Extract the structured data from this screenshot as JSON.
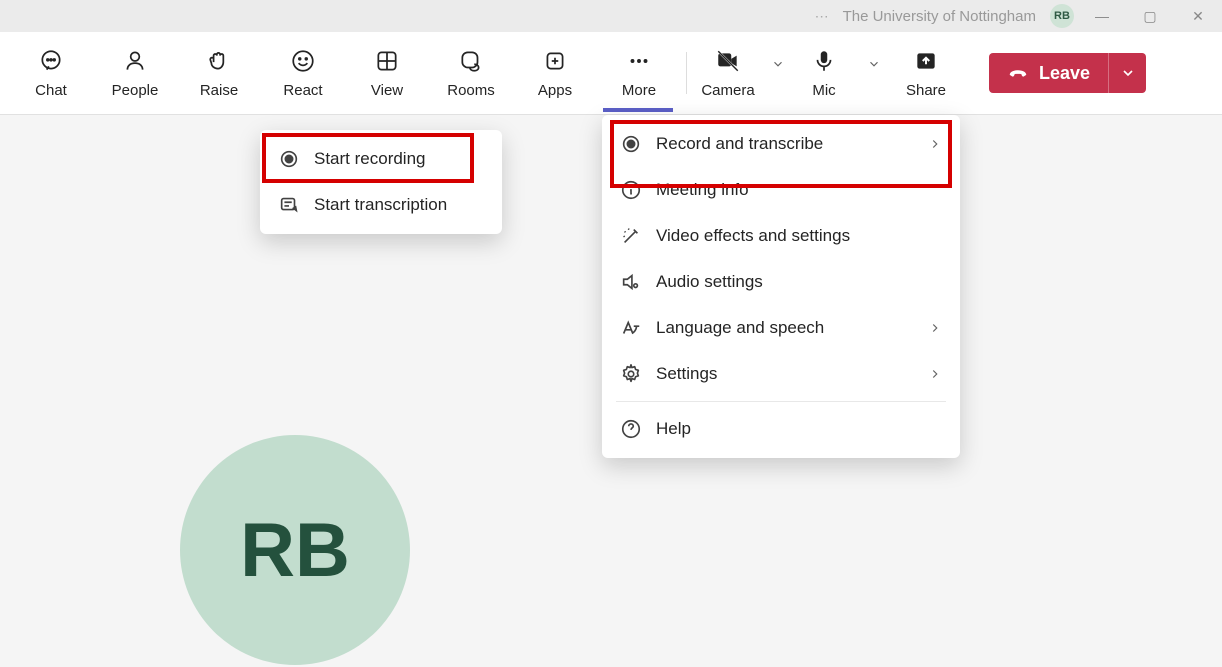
{
  "titlebar": {
    "org": "The University of Nottingham",
    "initials": "RB"
  },
  "toolbar": {
    "chat": "Chat",
    "people": "People",
    "raise": "Raise",
    "react": "React",
    "view": "View",
    "rooms": "Rooms",
    "apps": "Apps",
    "more": "More",
    "camera": "Camera",
    "mic": "Mic",
    "share": "Share",
    "leave": "Leave"
  },
  "submenu": {
    "start_recording": "Start recording",
    "start_transcription": "Start transcription"
  },
  "mainmenu": {
    "record": "Record and transcribe",
    "meeting_info": "Meeting info",
    "video_effects": "Video effects and settings",
    "audio": "Audio settings",
    "language": "Language and speech",
    "settings": "Settings",
    "help": "Help"
  },
  "avatar": {
    "initials": "RB"
  }
}
